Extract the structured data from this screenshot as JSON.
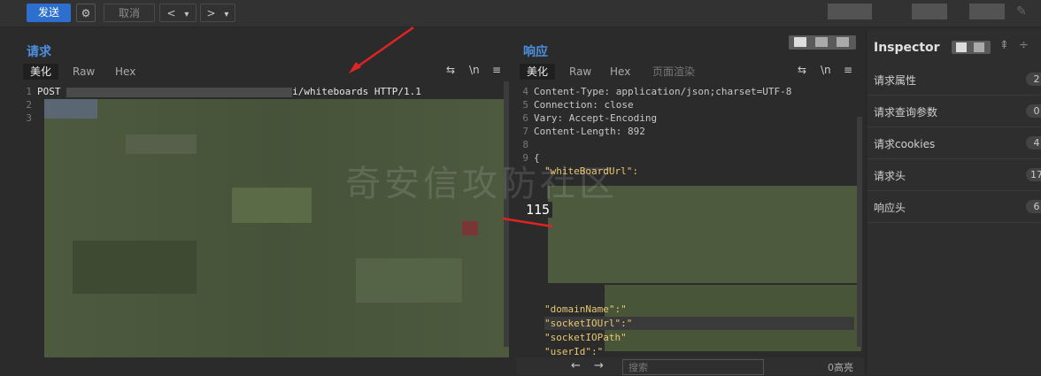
{
  "toolbar": {
    "send_label": "发送",
    "cancel_label": "取消",
    "prev_label": "<",
    "next_label": ">",
    "dropdown_glyph": "▾",
    "gear_glyph": "⚙"
  },
  "request": {
    "title": "请求",
    "tabs": [
      "美化",
      "Raw",
      "Hex"
    ],
    "line_numbers": [
      "1",
      "2",
      "3"
    ],
    "line1_method": "POST",
    "line1_path": "i/whiteboards HTTP/1.1"
  },
  "response": {
    "title": "响应",
    "tabs": [
      "美化",
      "Raw",
      "Hex",
      "页面渲染"
    ],
    "lines": [
      {
        "n": "4",
        "text": "Content-Type: application/json;charset=UTF-8"
      },
      {
        "n": "5",
        "text": "Connection: close"
      },
      {
        "n": "6",
        "text": "Vary: Accept-Encoding"
      },
      {
        "n": "7",
        "text": "Content-Length: 892"
      },
      {
        "n": "8",
        "text": ""
      },
      {
        "n": "9",
        "text": "{"
      }
    ],
    "keys": [
      "\"whiteBoardUrl\":",
      "\"domainName\":\"",
      "\"socketIOUrl\":\"",
      "\"socketIOPath\"",
      "\"userId\":\""
    ],
    "overlay_number": "115",
    "search_placeholder": "搜索",
    "match_count": "0高亮"
  },
  "editor_icons": {
    "wrap": "⇆",
    "newline": "\\n",
    "menu": "≡"
  },
  "inspector": {
    "title": "Inspector",
    "rows": [
      {
        "label": "请求属性",
        "count": "2"
      },
      {
        "label": "请求查询参数",
        "count": "0"
      },
      {
        "label": "请求cookies",
        "count": "4"
      },
      {
        "label": "请求头",
        "count": "17"
      },
      {
        "label": "响应头",
        "count": "6"
      }
    ]
  },
  "watermark": "奇安信攻防社区",
  "colors": {
    "accent": "#2d6fcf",
    "title_blue": "#4d8fe0",
    "json_key": "#e8c770",
    "bg": "#2b2b2b"
  }
}
